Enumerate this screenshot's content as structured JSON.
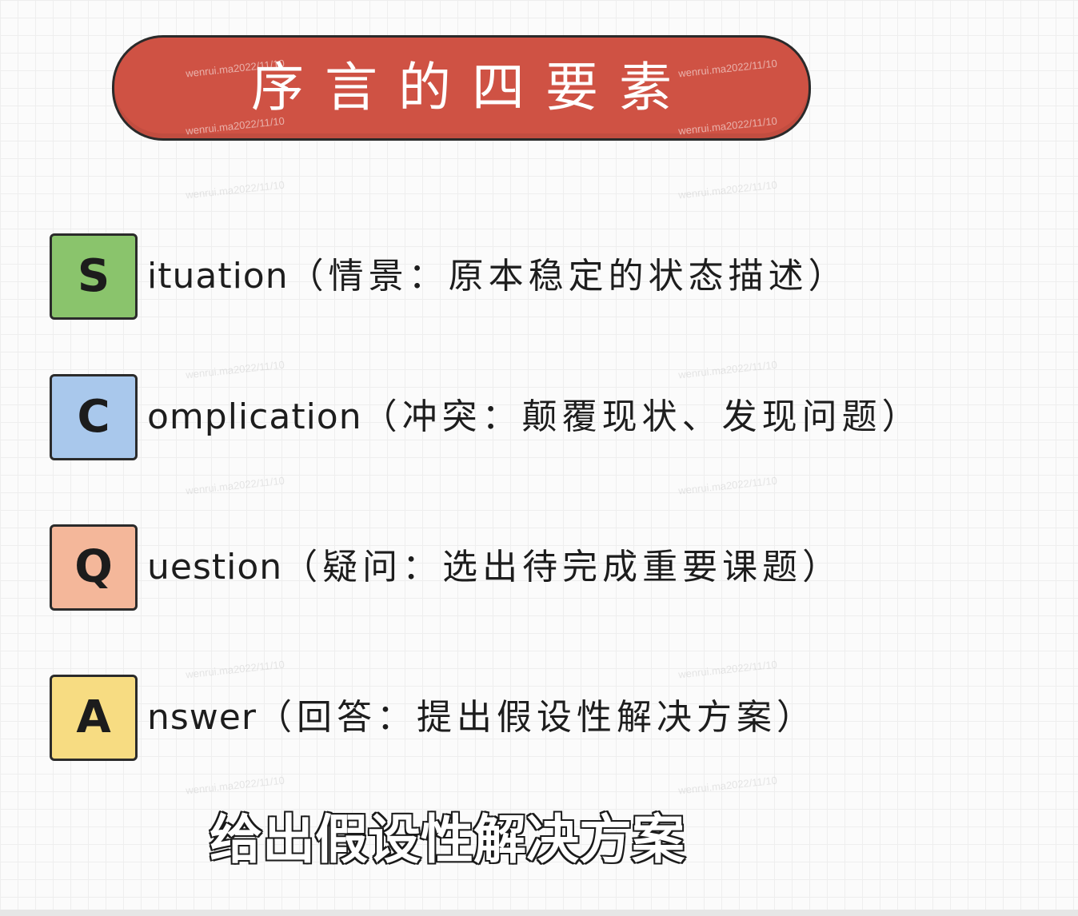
{
  "title": "序言的四要素",
  "watermark_text": "wenrui.ma2022/11/10",
  "elements": [
    {
      "letter": "S",
      "rest": "ituation",
      "description": "（情景：原本稳定的状态描述）",
      "color": "#8ac46c"
    },
    {
      "letter": "C",
      "rest": "omplication",
      "description": "（冲突：颠覆现状、发现问题）",
      "color": "#a9c8ec"
    },
    {
      "letter": "Q",
      "rest": "uestion",
      "description": "（疑问：选出待完成重要课题）",
      "color": "#f4b79a"
    },
    {
      "letter": "A",
      "rest": "nswer",
      "description": "（回答：提出假设性解决方案）",
      "color": "#f7dc82"
    }
  ],
  "subtitle": "给出假设性解决方案"
}
